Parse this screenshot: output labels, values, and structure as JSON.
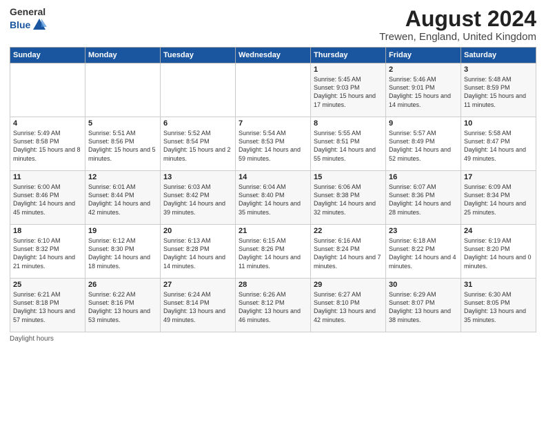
{
  "header": {
    "logo_general": "General",
    "logo_blue": "Blue",
    "title": "August 2024",
    "subtitle": "Trewen, England, United Kingdom"
  },
  "days_of_week": [
    "Sunday",
    "Monday",
    "Tuesday",
    "Wednesday",
    "Thursday",
    "Friday",
    "Saturday"
  ],
  "weeks": [
    [
      {
        "day": "",
        "content": ""
      },
      {
        "day": "",
        "content": ""
      },
      {
        "day": "",
        "content": ""
      },
      {
        "day": "",
        "content": ""
      },
      {
        "day": "1",
        "content": "Sunrise: 5:45 AM\nSunset: 9:03 PM\nDaylight: 15 hours and 17 minutes."
      },
      {
        "day": "2",
        "content": "Sunrise: 5:46 AM\nSunset: 9:01 PM\nDaylight: 15 hours and 14 minutes."
      },
      {
        "day": "3",
        "content": "Sunrise: 5:48 AM\nSunset: 8:59 PM\nDaylight: 15 hours and 11 minutes."
      }
    ],
    [
      {
        "day": "4",
        "content": "Sunrise: 5:49 AM\nSunset: 8:58 PM\nDaylight: 15 hours and 8 minutes."
      },
      {
        "day": "5",
        "content": "Sunrise: 5:51 AM\nSunset: 8:56 PM\nDaylight: 15 hours and 5 minutes."
      },
      {
        "day": "6",
        "content": "Sunrise: 5:52 AM\nSunset: 8:54 PM\nDaylight: 15 hours and 2 minutes."
      },
      {
        "day": "7",
        "content": "Sunrise: 5:54 AM\nSunset: 8:53 PM\nDaylight: 14 hours and 59 minutes."
      },
      {
        "day": "8",
        "content": "Sunrise: 5:55 AM\nSunset: 8:51 PM\nDaylight: 14 hours and 55 minutes."
      },
      {
        "day": "9",
        "content": "Sunrise: 5:57 AM\nSunset: 8:49 PM\nDaylight: 14 hours and 52 minutes."
      },
      {
        "day": "10",
        "content": "Sunrise: 5:58 AM\nSunset: 8:47 PM\nDaylight: 14 hours and 49 minutes."
      }
    ],
    [
      {
        "day": "11",
        "content": "Sunrise: 6:00 AM\nSunset: 8:46 PM\nDaylight: 14 hours and 45 minutes."
      },
      {
        "day": "12",
        "content": "Sunrise: 6:01 AM\nSunset: 8:44 PM\nDaylight: 14 hours and 42 minutes."
      },
      {
        "day": "13",
        "content": "Sunrise: 6:03 AM\nSunset: 8:42 PM\nDaylight: 14 hours and 39 minutes."
      },
      {
        "day": "14",
        "content": "Sunrise: 6:04 AM\nSunset: 8:40 PM\nDaylight: 14 hours and 35 minutes."
      },
      {
        "day": "15",
        "content": "Sunrise: 6:06 AM\nSunset: 8:38 PM\nDaylight: 14 hours and 32 minutes."
      },
      {
        "day": "16",
        "content": "Sunrise: 6:07 AM\nSunset: 8:36 PM\nDaylight: 14 hours and 28 minutes."
      },
      {
        "day": "17",
        "content": "Sunrise: 6:09 AM\nSunset: 8:34 PM\nDaylight: 14 hours and 25 minutes."
      }
    ],
    [
      {
        "day": "18",
        "content": "Sunrise: 6:10 AM\nSunset: 8:32 PM\nDaylight: 14 hours and 21 minutes."
      },
      {
        "day": "19",
        "content": "Sunrise: 6:12 AM\nSunset: 8:30 PM\nDaylight: 14 hours and 18 minutes."
      },
      {
        "day": "20",
        "content": "Sunrise: 6:13 AM\nSunset: 8:28 PM\nDaylight: 14 hours and 14 minutes."
      },
      {
        "day": "21",
        "content": "Sunrise: 6:15 AM\nSunset: 8:26 PM\nDaylight: 14 hours and 11 minutes."
      },
      {
        "day": "22",
        "content": "Sunrise: 6:16 AM\nSunset: 8:24 PM\nDaylight: 14 hours and 7 minutes."
      },
      {
        "day": "23",
        "content": "Sunrise: 6:18 AM\nSunset: 8:22 PM\nDaylight: 14 hours and 4 minutes."
      },
      {
        "day": "24",
        "content": "Sunrise: 6:19 AM\nSunset: 8:20 PM\nDaylight: 14 hours and 0 minutes."
      }
    ],
    [
      {
        "day": "25",
        "content": "Sunrise: 6:21 AM\nSunset: 8:18 PM\nDaylight: 13 hours and 57 minutes."
      },
      {
        "day": "26",
        "content": "Sunrise: 6:22 AM\nSunset: 8:16 PM\nDaylight: 13 hours and 53 minutes."
      },
      {
        "day": "27",
        "content": "Sunrise: 6:24 AM\nSunset: 8:14 PM\nDaylight: 13 hours and 49 minutes."
      },
      {
        "day": "28",
        "content": "Sunrise: 6:26 AM\nSunset: 8:12 PM\nDaylight: 13 hours and 46 minutes."
      },
      {
        "day": "29",
        "content": "Sunrise: 6:27 AM\nSunset: 8:10 PM\nDaylight: 13 hours and 42 minutes."
      },
      {
        "day": "30",
        "content": "Sunrise: 6:29 AM\nSunset: 8:07 PM\nDaylight: 13 hours and 38 minutes."
      },
      {
        "day": "31",
        "content": "Sunrise: 6:30 AM\nSunset: 8:05 PM\nDaylight: 13 hours and 35 minutes."
      }
    ]
  ],
  "footer": {
    "note": "Daylight hours"
  }
}
